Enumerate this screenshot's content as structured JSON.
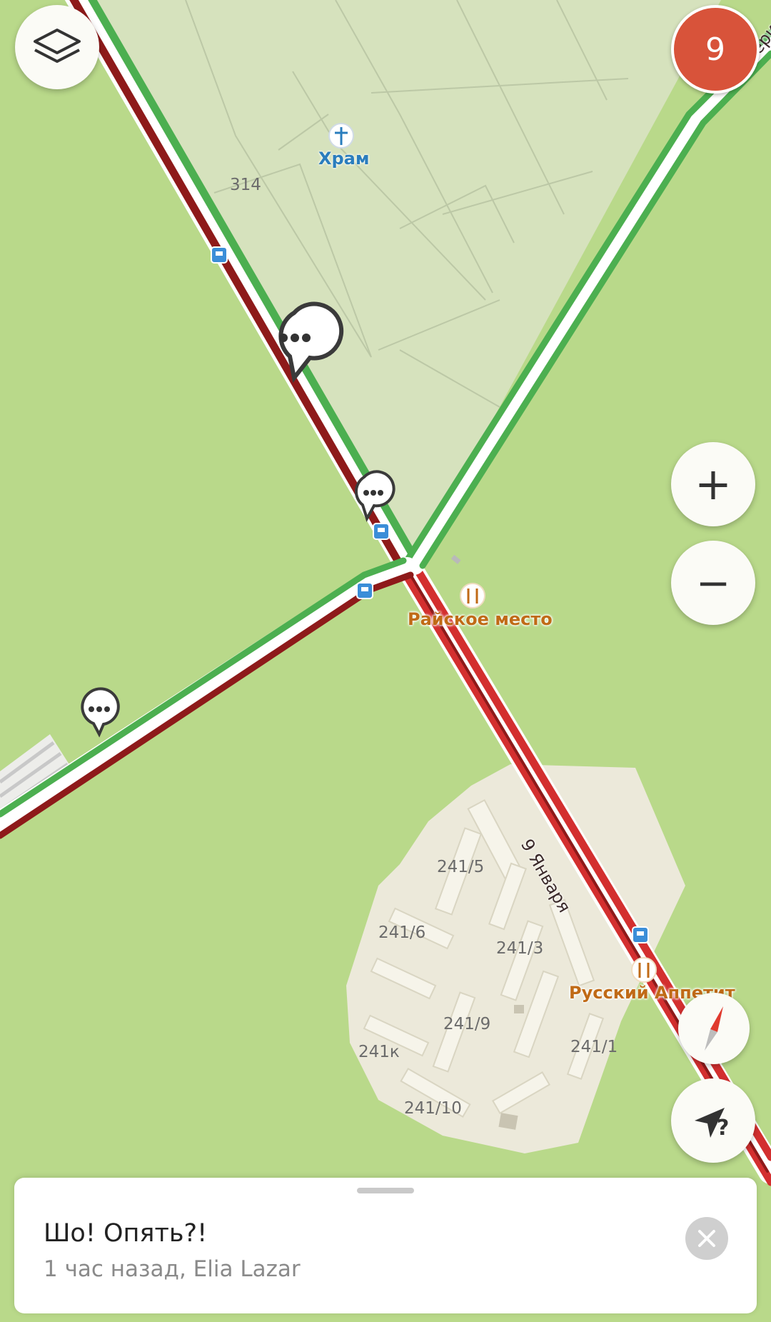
{
  "map": {
    "labels": {
      "temple": "Храм",
      "plot_314": "314",
      "restaurant_1": "Райское место",
      "restaurant_2": "Русский Аппетит",
      "street_9jan": "9 Января",
      "street_ekat": "Екатери",
      "b_241_5": "241/5",
      "b_241_6": "241/6",
      "b_241_3": "241/3",
      "b_241_9": "241/9",
      "b_241k": "241к",
      "b_241_1": "241/1",
      "b_241_10": "241/10"
    },
    "colors": {
      "background": "#b9d98a",
      "area": "#d6e2bd",
      "buildings": "#ece9da",
      "traffic_free": "#4caf50",
      "traffic_jam": "#8e1a1a",
      "traffic_heavy": "#d32f2f"
    },
    "icons": [
      "layers-icon",
      "plus-icon",
      "minus-icon",
      "compass-icon",
      "locate-question-icon",
      "bus-stop-icon",
      "restaurant-icon",
      "church-icon",
      "chat-bubble-icon"
    ]
  },
  "controls": {
    "events_count": "9",
    "zoom_in": "+",
    "zoom_out": "−",
    "locate_q": "?"
  },
  "sheet": {
    "title": "Шо! Опять?!",
    "subtitle": "1 час назад, Elia Lazar"
  }
}
